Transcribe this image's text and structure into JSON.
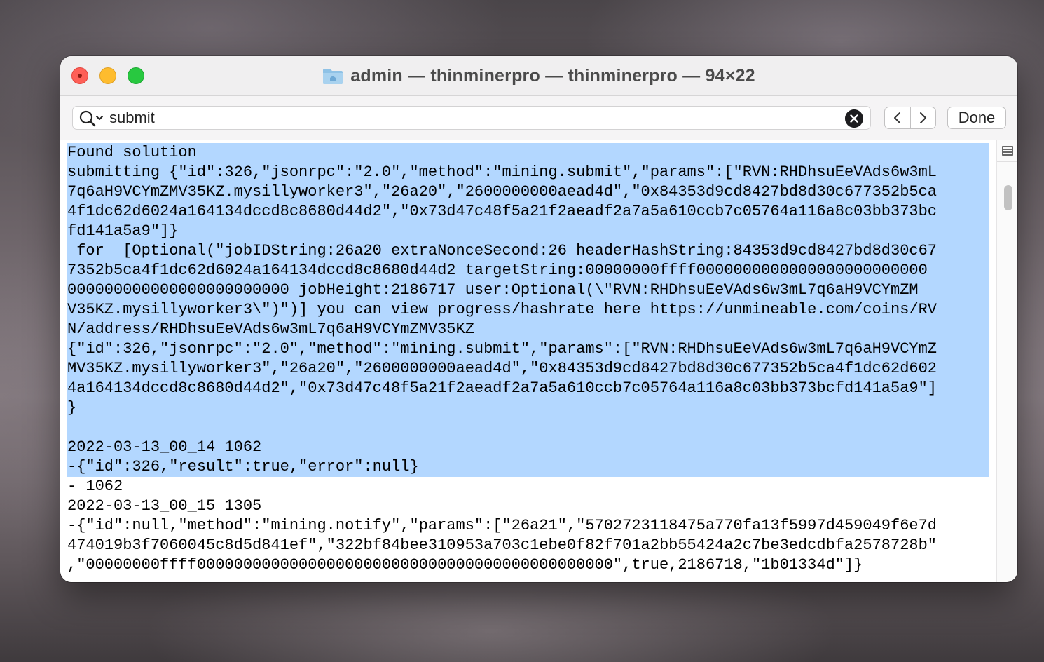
{
  "window": {
    "title": "admin — thinminerpro — thinminerpro — 94×22"
  },
  "search": {
    "value": "submit",
    "done_label": "Done"
  },
  "terminal": {
    "lines": [
      {
        "text": "Found solution",
        "selected": true
      },
      {
        "text": "submitting {\"id\":326,\"jsonrpc\":\"2.0\",\"method\":\"mining.submit\",\"params\":[\"RVN:RHDhsuEeVAds6w3mL",
        "selected": true
      },
      {
        "text": "7q6aH9VCYmZMV35KZ.mysillyworker3\",\"26a20\",\"2600000000aead4d\",\"0x84353d9cd8427bd8d30c677352b5ca",
        "selected": true
      },
      {
        "text": "4f1dc62d6024a164134dccd8c8680d44d2\",\"0x73d47c48f5a21f2aeadf2a7a5a610ccb7c05764a116a8c03bb373bc",
        "selected": true
      },
      {
        "text": "fd141a5a9\"]}",
        "selected": true
      },
      {
        "text": " for  [Optional(\"jobIDString:26a20 extraNonceSecond:26 headerHashString:84353d9cd8427bd8d30c67",
        "selected": true
      },
      {
        "text": "7352b5ca4f1dc62d6024a164134dccd8c8680d44d2 targetString:00000000ffff0000000000000000000000000",
        "selected": true
      },
      {
        "text": "000000000000000000000000 jobHeight:2186717 user:Optional(\\\"RVN:RHDhsuEeVAds6w3mL7q6aH9VCYmZM",
        "selected": true
      },
      {
        "text": "V35KZ.mysillyworker3\\\")\")] you can view progress/hashrate here https://unmineable.com/coins/RV",
        "selected": true
      },
      {
        "text": "N/address/RHDhsuEeVAds6w3mL7q6aH9VCYmZMV35KZ",
        "selected": true
      },
      {
        "text": "{\"id\":326,\"jsonrpc\":\"2.0\",\"method\":\"mining.submit\",\"params\":[\"RVN:RHDhsuEeVAds6w3mL7q6aH9VCYmZ",
        "selected": true
      },
      {
        "text": "MV35KZ.mysillyworker3\",\"26a20\",\"2600000000aead4d\",\"0x84353d9cd8427bd8d30c677352b5ca4f1dc62d602",
        "selected": true
      },
      {
        "text": "4a164134dccd8c8680d44d2\",\"0x73d47c48f5a21f2aeadf2a7a5a610ccb7c05764a116a8c03bb373bcfd141a5a9\"]",
        "selected": true
      },
      {
        "text": "}",
        "selected": true
      },
      {
        "text": "",
        "selected": true
      },
      {
        "text": "2022-03-13_00_14 1062",
        "selected": true
      },
      {
        "text": "-{\"id\":326,\"result\":true,\"error\":null}",
        "selected": true
      },
      {
        "text": "- 1062",
        "selected": false
      },
      {
        "text": "2022-03-13_00_15 1305",
        "selected": false
      },
      {
        "text": "-{\"id\":null,\"method\":\"mining.notify\",\"params\":[\"26a21\",\"5702723118475a770fa13f5997d459049f6e7d",
        "selected": false
      },
      {
        "text": "474019b3f7060045c8d5d841ef\",\"322bf84bee310953a703c1ebe0f82f701a2bb55424a2c7be3edcdbfa2578728b\"",
        "selected": false
      },
      {
        "text": ",\"00000000ffff000000000000000000000000000000000000000000000\",true,2186718,\"1b01334d\"]}",
        "selected": false
      }
    ]
  },
  "colors": {
    "selection": "#b3d7ff",
    "close": "#fe5f57",
    "minimize": "#febc2e",
    "maximize": "#28c840"
  },
  "icons": [
    "folder-icon",
    "magnifier-icon",
    "clear-search-icon",
    "chevron-left-icon",
    "chevron-right-icon",
    "marks-icon"
  ]
}
